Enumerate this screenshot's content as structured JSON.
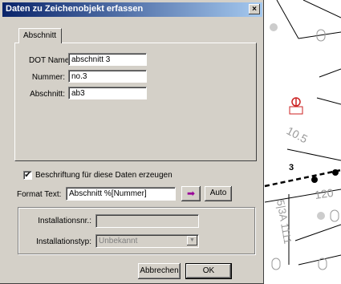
{
  "dialog": {
    "title": "Daten zu Zeichenobjekt erfassen",
    "close_label": "×",
    "tab_label": "Abschnitt",
    "fields": {
      "dot_name_label": "DOT Name:",
      "dot_name_value": "abschnitt 3",
      "nummer_label": "Nummer:",
      "nummer_value": "no.3",
      "abschnitt_label": "Abschnitt:",
      "abschnitt_value": "ab3"
    },
    "beschriftung": {
      "checkbox_checked": true,
      "checkbox_mark": "✔",
      "label": "Beschriftung für diese Daten erzeugen"
    },
    "format_text": {
      "label": "Format Text:",
      "value": "Abschnitt %[Nummer]",
      "arrow_icon": "➡",
      "auto_label": "Auto"
    },
    "installation": {
      "nr_label": "Installationsnr.:",
      "nr_value": "",
      "typ_label": "Installationstyp:",
      "typ_value": "Unbekannt",
      "dropdown_icon": "▼"
    },
    "buttons": {
      "cancel": "Abbrechen",
      "ok": "OK"
    }
  },
  "map": {
    "labels": {
      "l1": "10.5",
      "l2": "3",
      "l3": "120",
      "l4": "5|3A 1111"
    },
    "colors": {
      "line": "#000000",
      "marker_red": "#cc2222",
      "label_gray": "#9a9a9a"
    }
  }
}
